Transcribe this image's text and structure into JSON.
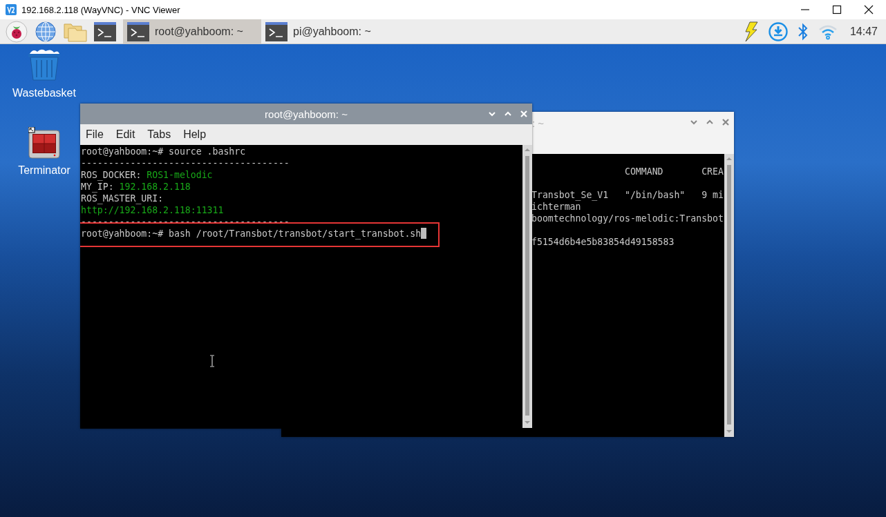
{
  "window": {
    "title": "192.168.2.118 (WayVNC) - VNC Viewer"
  },
  "taskbar": {
    "tasks": [
      {
        "label": "root@yahboom: ~",
        "selected": true
      },
      {
        "label": "pi@yahboom: ~",
        "selected": false
      }
    ],
    "clock": "14:47"
  },
  "desktop_icons": [
    {
      "kind": "trash",
      "label": "Wastebasket"
    },
    {
      "kind": "terminator",
      "label": "Terminator"
    }
  ],
  "windows": [
    {
      "title": ": ~",
      "active": false,
      "lines": [
        {
          "after_blank": false,
          "segments": [
            {
              "text": "                 COMMAND       CREA",
              "kind": "plain"
            }
          ]
        },
        {
          "after_blank": true,
          "segments": [
            {
              "text": "Transbot_Se_V1   \"/bin/bash\"   9 mi",
              "kind": "plain"
            }
          ]
        },
        {
          "after_blank": false,
          "segments": [
            {
              "text": "ichterman",
              "kind": "plain"
            }
          ]
        },
        {
          "after_blank": false,
          "segments": [
            {
              "text": "boomtechnology/ros-melodic:Transbot",
              "kind": "plain"
            }
          ]
        },
        {
          "after_blank": true,
          "segments": [
            {
              "text": "f5154d6b4e5b83854d49158583",
              "kind": "plain"
            }
          ]
        }
      ]
    },
    {
      "title": "root@yahboom: ~",
      "active": true,
      "menu": [
        "File",
        "Edit",
        "Tabs",
        "Help"
      ],
      "lines": [
        {
          "after_blank": false,
          "segments": [
            {
              "text": "root@yahboom:~# source .bashrc",
              "kind": "plain"
            }
          ]
        },
        {
          "after_blank": false,
          "segments": [
            {
              "text": "--------------------------------------",
              "kind": "plain"
            }
          ]
        },
        {
          "after_blank": false,
          "segments": [
            {
              "text": "ROS_DOCKER: ",
              "kind": "plain"
            },
            {
              "text": "ROS1-melodic",
              "kind": "value"
            }
          ]
        },
        {
          "after_blank": false,
          "segments": [
            {
              "text": "MY_IP: ",
              "kind": "plain"
            },
            {
              "text": "192.168.2.118",
              "kind": "value"
            }
          ]
        },
        {
          "after_blank": false,
          "segments": [
            {
              "text": "ROS_MASTER_URI:",
              "kind": "plain"
            }
          ]
        },
        {
          "after_blank": false,
          "segments": [
            {
              "text": "http://192.168.2.118:11311",
              "kind": "value"
            }
          ]
        },
        {
          "after_blank": false,
          "segments": [
            {
              "text": "--------------------------------------",
              "kind": "plain"
            }
          ]
        },
        {
          "after_blank": false,
          "highlighted": true,
          "cursor": true,
          "segments": [
            {
              "text": "root@yahboom:~# bash /root/Transbot/transbot/start_transbot.sh",
              "kind": "plain"
            }
          ]
        }
      ]
    }
  ]
}
